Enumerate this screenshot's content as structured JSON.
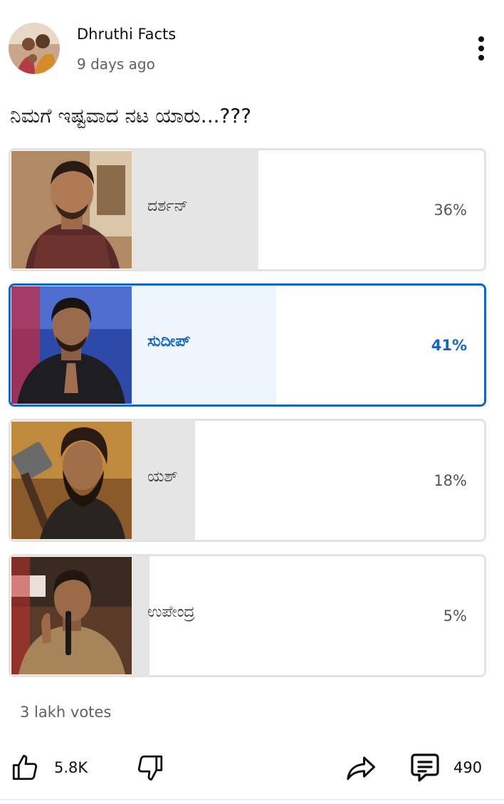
{
  "post": {
    "channel_name": "Dhruthi Facts",
    "time_ago": "9 days ago",
    "question": "ನಿಮಗೆ ಇಷ್ಟವಾದ ನಟ ಯಾರು...???"
  },
  "poll": {
    "options": [
      {
        "label": "ದರ್ಶನ್",
        "percent_label": "36%",
        "percent": 36,
        "selected": false
      },
      {
        "label": "ಸುದೀಪ್",
        "percent_label": "41%",
        "percent": 41,
        "selected": true
      },
      {
        "label": "ಯಶ್",
        "percent_label": "18%",
        "percent": 18,
        "selected": false
      },
      {
        "label": "ಉಪೇಂದ್ರ",
        "percent_label": "5%",
        "percent": 5,
        "selected": false
      }
    ],
    "votes": "3 lakh votes"
  },
  "actions": {
    "like_count": "5.8K",
    "comment_count": "490"
  },
  "colors": {
    "selected_accent": "#1565c0",
    "bar_fill": "#e5e5e5",
    "selected_bar_fill": "#eef5fd"
  },
  "icons": {
    "menu": "more-vert-icon",
    "like": "thumbs-up-icon",
    "dislike": "thumbs-down-icon",
    "share": "share-arrow-icon",
    "comments": "comment-bubble-icon"
  }
}
